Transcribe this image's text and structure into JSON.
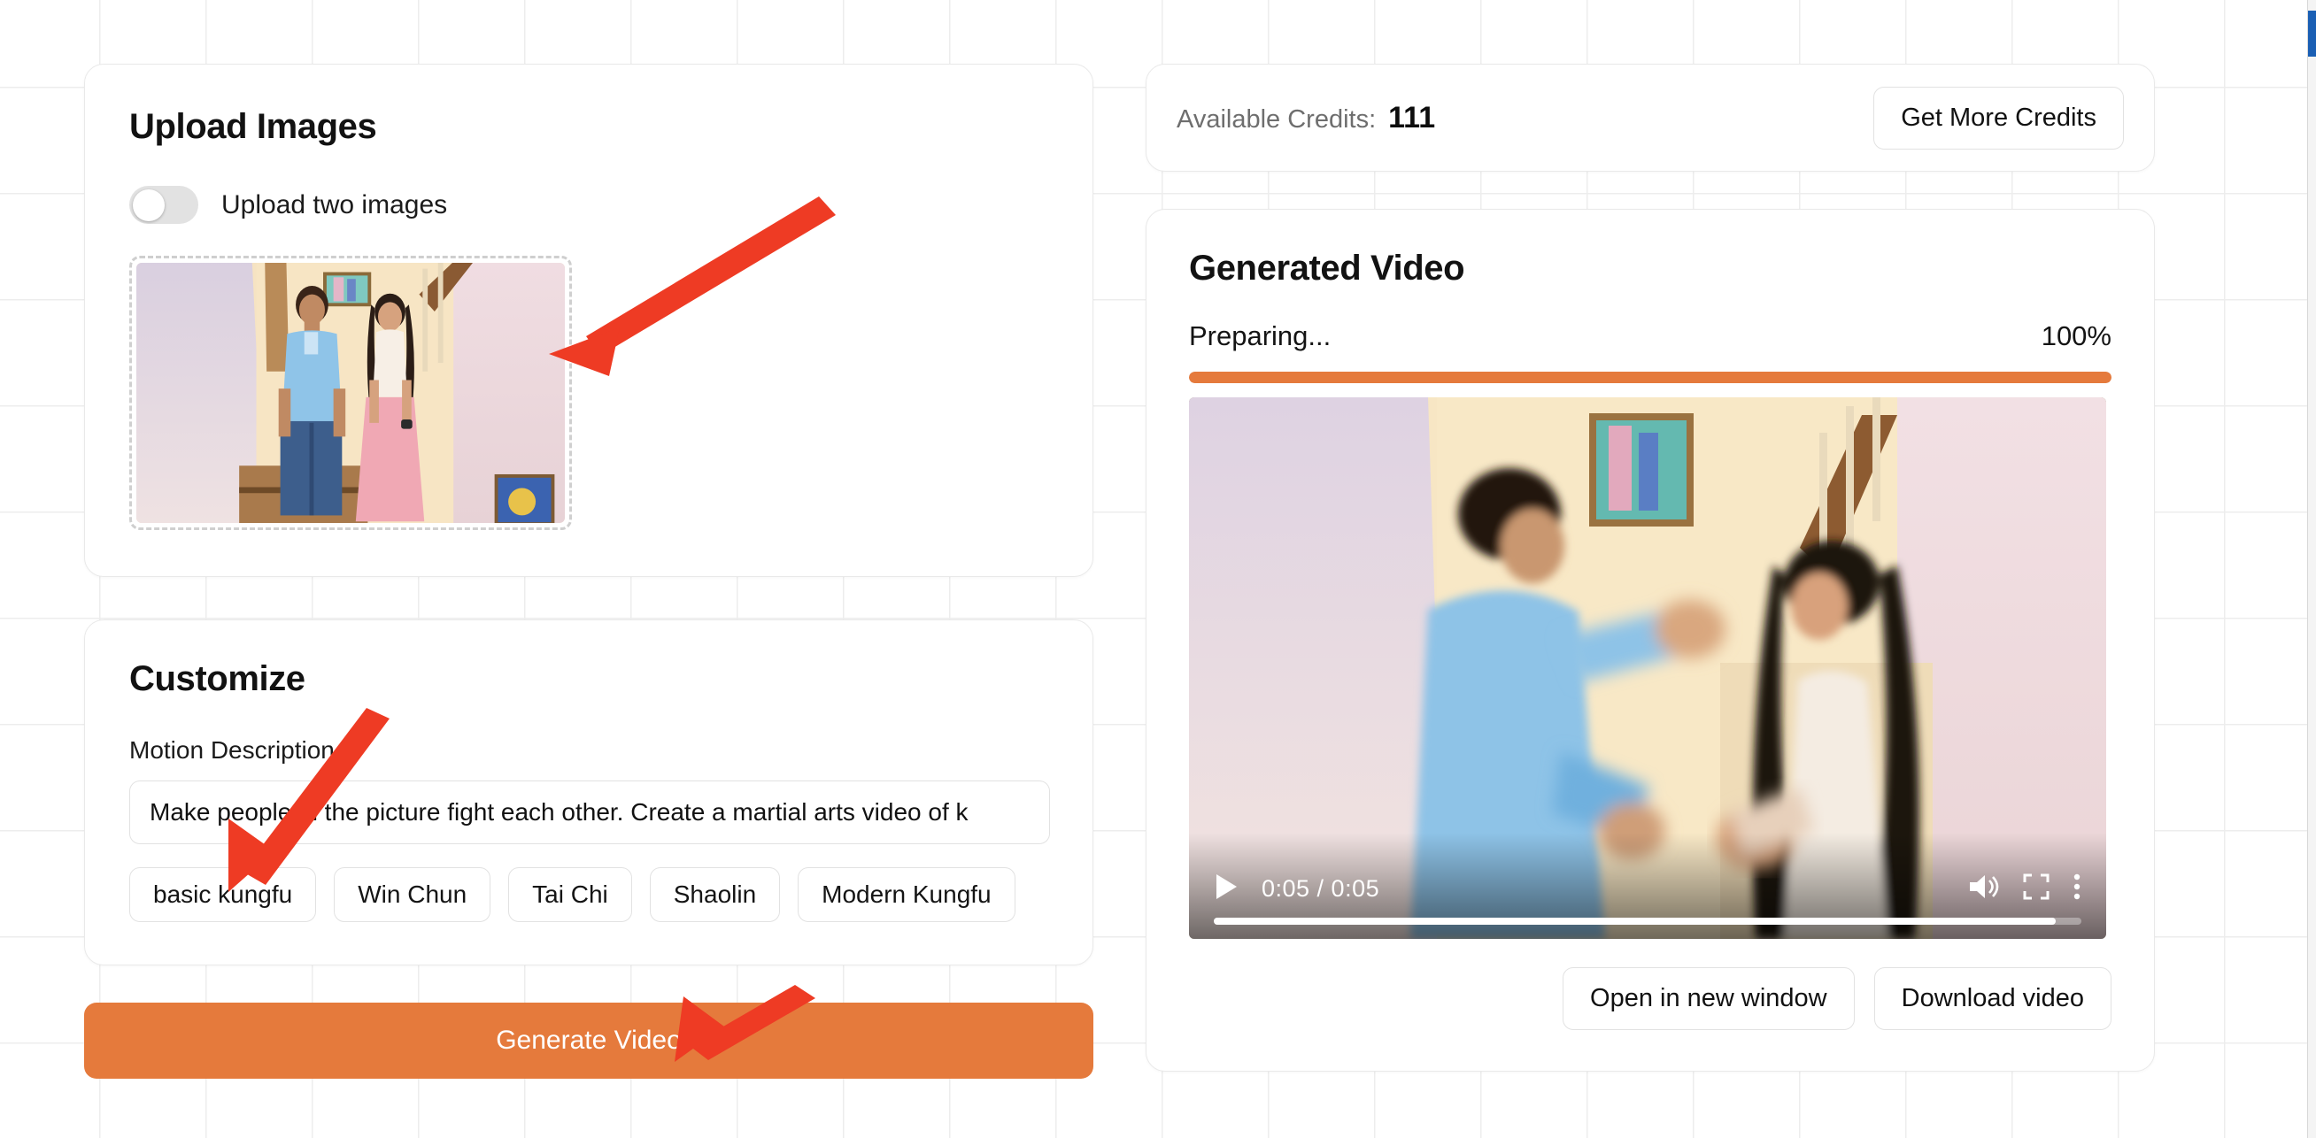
{
  "upload": {
    "title": "Upload Images",
    "toggle_label": "Upload two images",
    "toggle_state": "off",
    "thumbnail_alt": "couple standing on staircase"
  },
  "customize": {
    "title": "Customize",
    "motion_label": "Motion Description",
    "motion_value": "Make people in the picture fight each other. Create a martial arts video of k",
    "chips": [
      {
        "label": "basic kungfu"
      },
      {
        "label": "Win Chun"
      },
      {
        "label": "Tai Chi"
      },
      {
        "label": "Shaolin"
      },
      {
        "label": "Modern Kungfu"
      }
    ],
    "generate_label": "Generate Video"
  },
  "credits": {
    "label": "Available Credits:",
    "value": "111",
    "button_label": "Get More Credits"
  },
  "generated_video": {
    "title": "Generated Video",
    "status": "Preparing...",
    "percent": "100%",
    "progress_fill_pct": 100,
    "player": {
      "play_icon": "play-icon",
      "time": "0:05 / 0:05",
      "volume_icon": "volume-icon",
      "fullscreen_icon": "fullscreen-icon",
      "more_icon": "more-vertical-icon",
      "seek_pct": 97
    },
    "actions": [
      {
        "label": "Open in new window"
      },
      {
        "label": "Download video"
      }
    ]
  },
  "colors": {
    "accent_orange": "#E57A3C",
    "annotation_red": "#EE3B24",
    "card_border": "#e9e9e9",
    "grid_line": "#ededed"
  }
}
